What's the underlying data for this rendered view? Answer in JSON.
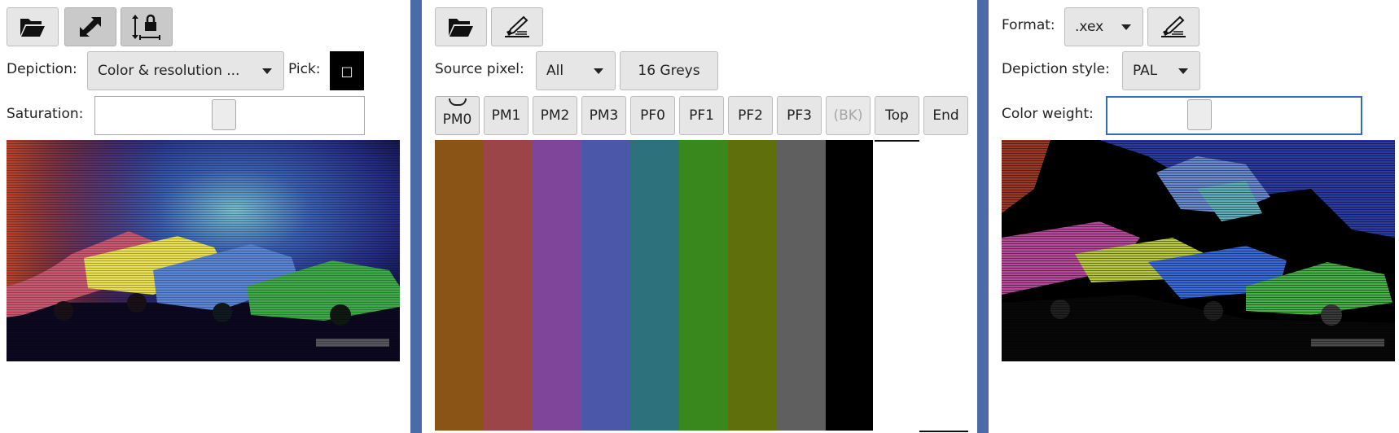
{
  "left": {
    "depiction_label": "Depiction:",
    "depiction_value": "Color & resolution ...",
    "pick_label": "Pick:",
    "pick_value": "□",
    "saturation_label": "Saturation:",
    "saturation_level": 0.48
  },
  "middle": {
    "source_pixel_label": "Source pixel:",
    "source_pixel_value": "All",
    "greys_button": "16 Greys",
    "register_buttons": [
      "PM0",
      "PM1",
      "PM2",
      "PM3",
      "PF0",
      "PF1",
      "PF2",
      "PF3",
      "(BK)",
      "Top",
      "End"
    ],
    "palette_colors": [
      "#8a5416",
      "#9b4549",
      "#7f459b",
      "#4b58a9",
      "#2d717c",
      "#38881e",
      "#5e6f0c",
      "#5f5f5f",
      "#000000"
    ]
  },
  "right": {
    "format_label": "Format:",
    "format_value": ".xex",
    "depiction_style_label": "Depiction style:",
    "depiction_style_value": "PAL",
    "color_weight_label": "Color weight:",
    "color_weight_level": 0.35
  }
}
